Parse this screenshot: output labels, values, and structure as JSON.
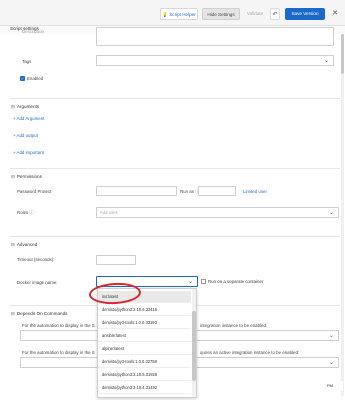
{
  "toolbar": {
    "script_helper": "Script Helper",
    "hide_settings": "Hide Settings",
    "validate": "Validate",
    "undo": "↶",
    "save_version": "Save Version",
    "close": "✕"
  },
  "panel": {
    "title": "Script settings"
  },
  "description_label": "Description",
  "tags_label": "Tags",
  "enabled_label": "Enabled",
  "arguments": {
    "title": "Arguments",
    "add_argument": "Add Argument",
    "add_output": "Add output",
    "add_important": "Add important"
  },
  "permissions": {
    "title": "Permissions",
    "password_protect": "Password Protect",
    "run_as": "Run as",
    "limited_user": "Limited user",
    "roles": "Roles",
    "add_roles_placeholder": "Add roles"
  },
  "advanced": {
    "title": "Advanced",
    "timeout": "Timeout (seconds):",
    "docker_image": "Docker image name:",
    "run_separate": "Run on a separate container"
  },
  "depends": {
    "title": "Depends On Commands",
    "line1_left": "For the automation to display in the S",
    "line1_right": "integration instance to be enabled:",
    "line2_left": "For the automation to display in the S",
    "line2_right": "quires an active integration instance to be enabled:"
  },
  "docker_options": [
    "ins:latest",
    "demisto/python3:3.10.6.33415",
    "demisto/py3-tools:1.0.0.33193",
    "ansible:latest",
    "alpine:latest",
    "demisto/py3-tools:1.0.0.32758",
    "demisto/python3:3.10.5.31928",
    "demisto/python3:3.10.4.31492"
  ],
  "badge": "PM"
}
